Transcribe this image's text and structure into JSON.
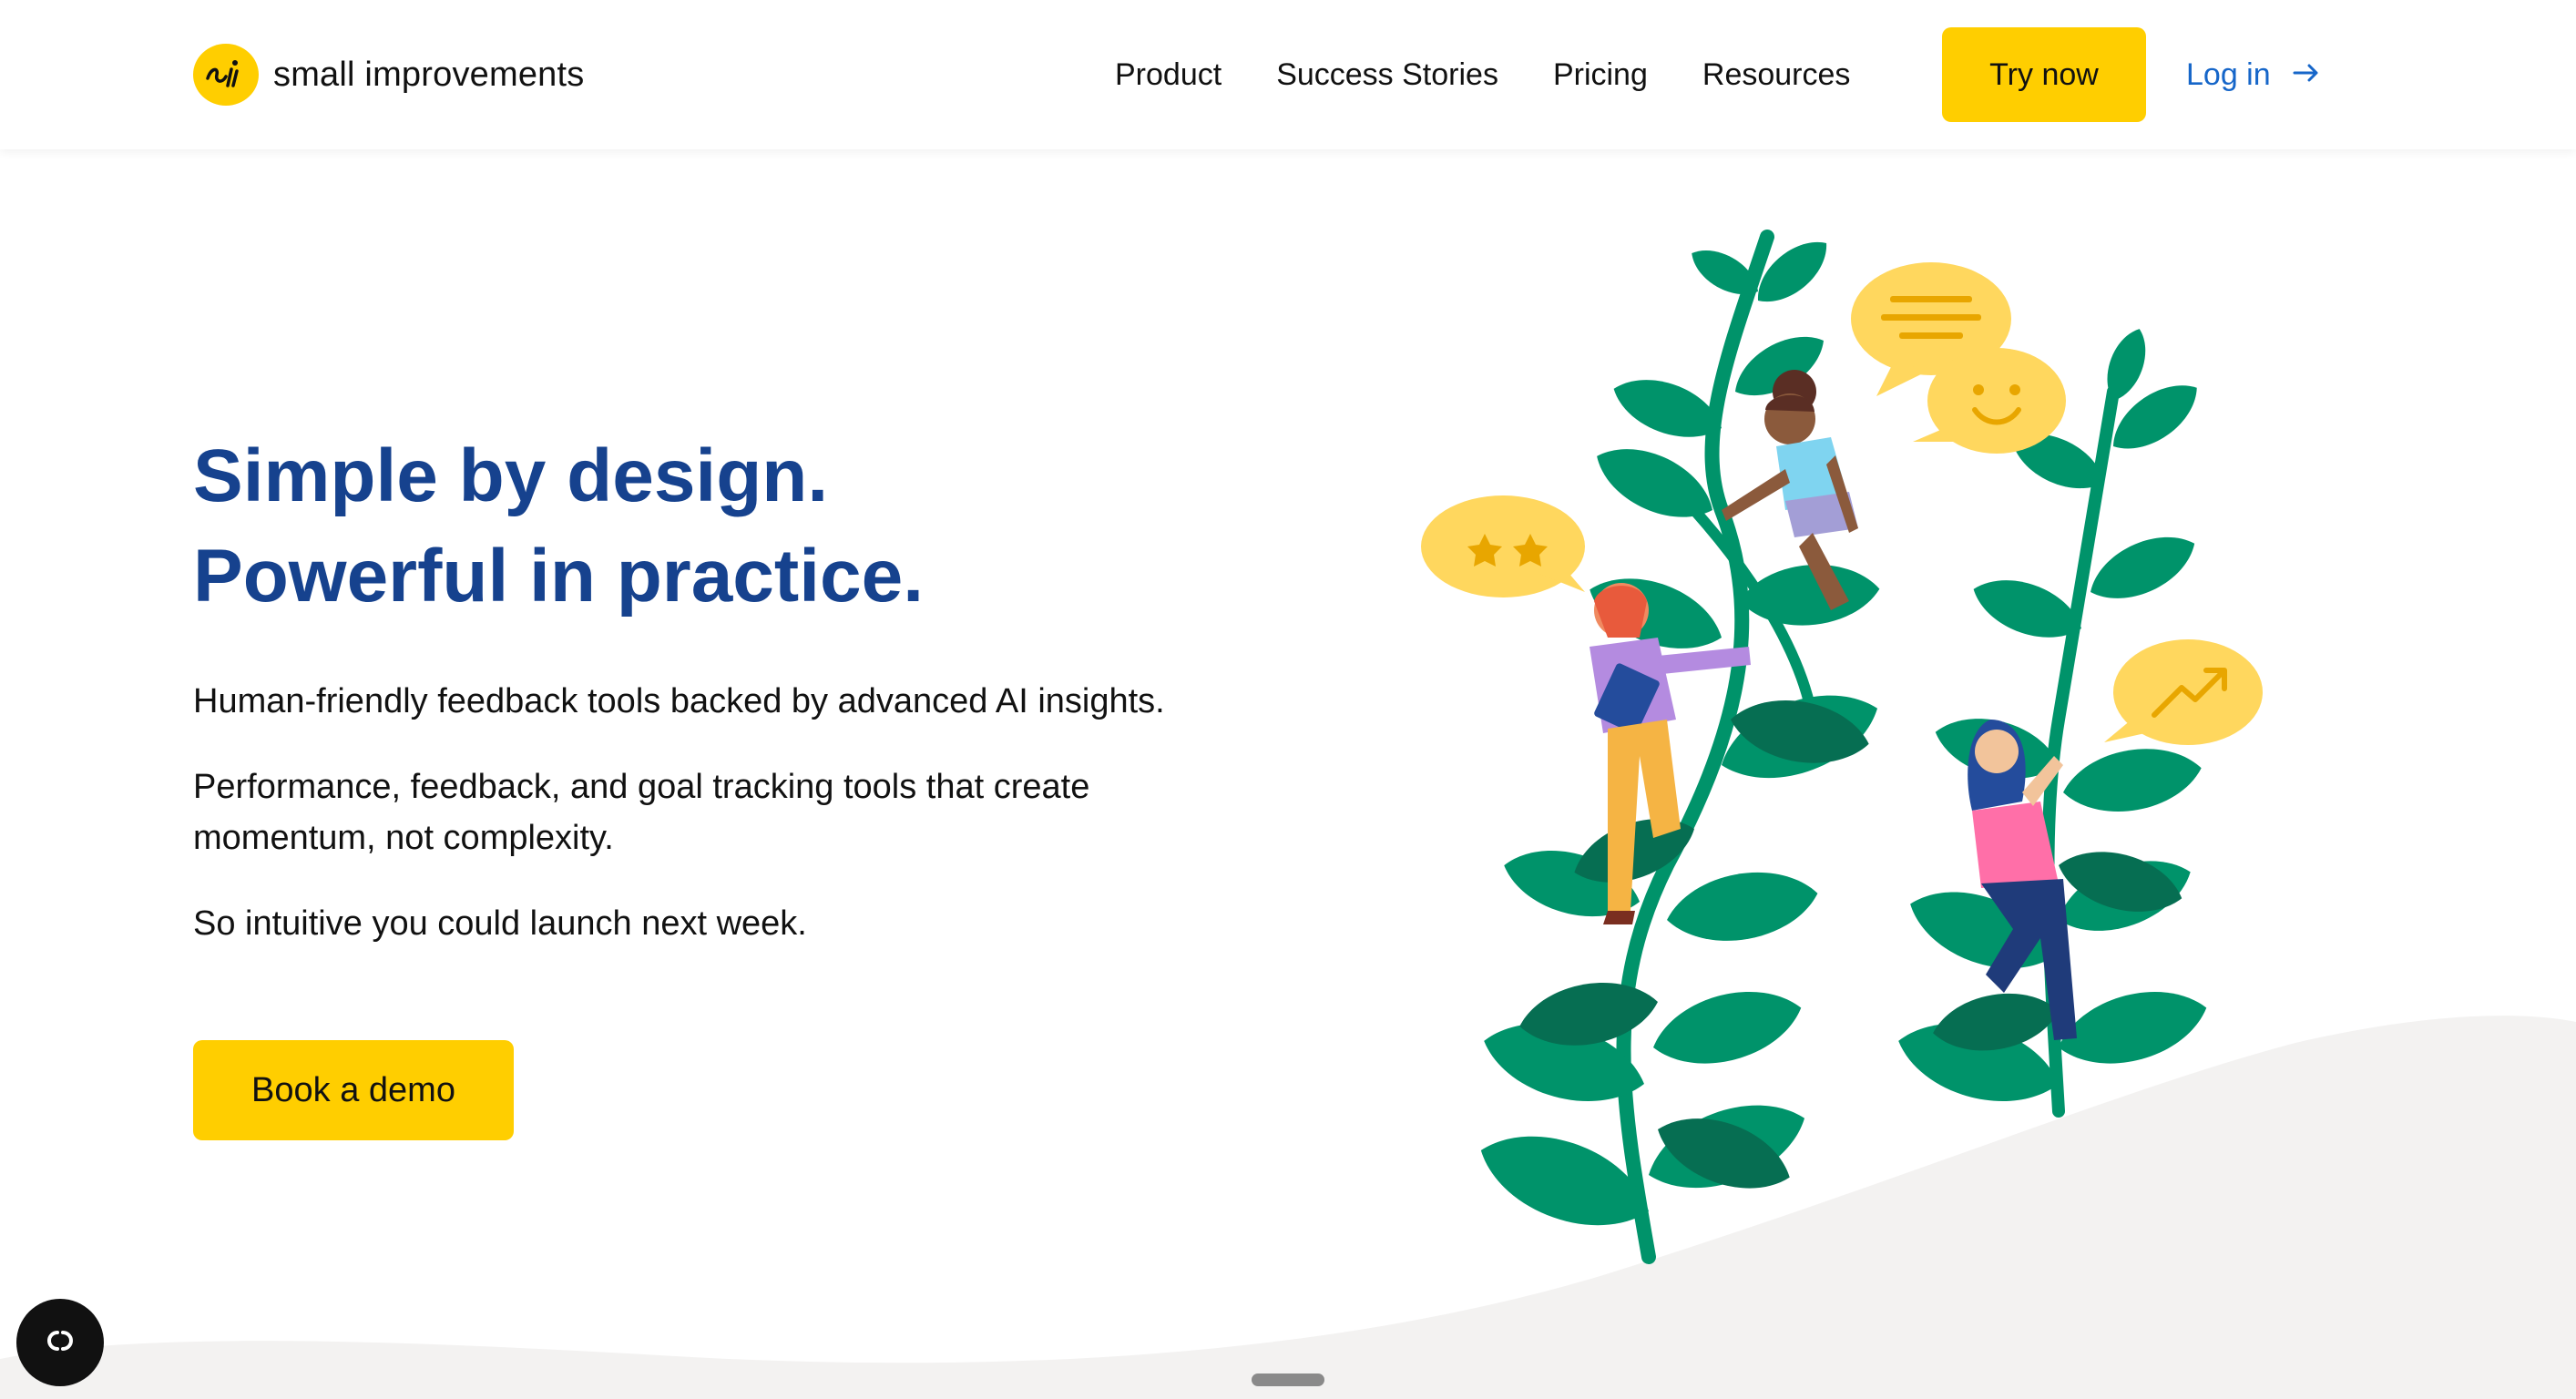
{
  "brand": {
    "logo_text": "si",
    "name": "small improvements"
  },
  "nav": {
    "items": [
      {
        "label": "Product"
      },
      {
        "label": "Success Stories"
      },
      {
        "label": "Pricing"
      },
      {
        "label": "Resources"
      }
    ],
    "cta_label": "Try now",
    "login_label": "Log in",
    "login_icon": "arrow-right-icon"
  },
  "hero": {
    "title_line1": "Simple by design.",
    "title_line2": "Powerful in practice.",
    "paragraph1": "Human-friendly feedback tools backed by advanced AI insights.",
    "paragraph2": "Performance, feedback, and goal tracking tools that create momentum, not complexity.",
    "paragraph3": "So intuitive you could launch next week.",
    "demo_label": "Book a demo"
  },
  "illustration": {
    "bubbles": [
      "stars-rating-icon",
      "text-lines-icon",
      "smiley-icon",
      "trend-up-icon"
    ]
  },
  "widgets": {
    "cookie_icon": "cookie-settings-icon",
    "scroll_icon": "scroll-handle"
  },
  "colors": {
    "accent_yellow": "#FFCE00",
    "heading_blue": "#16428E",
    "link_blue": "#1666C9",
    "leaf_green": "#00936A",
    "ground_gray": "#F3F2F1"
  }
}
